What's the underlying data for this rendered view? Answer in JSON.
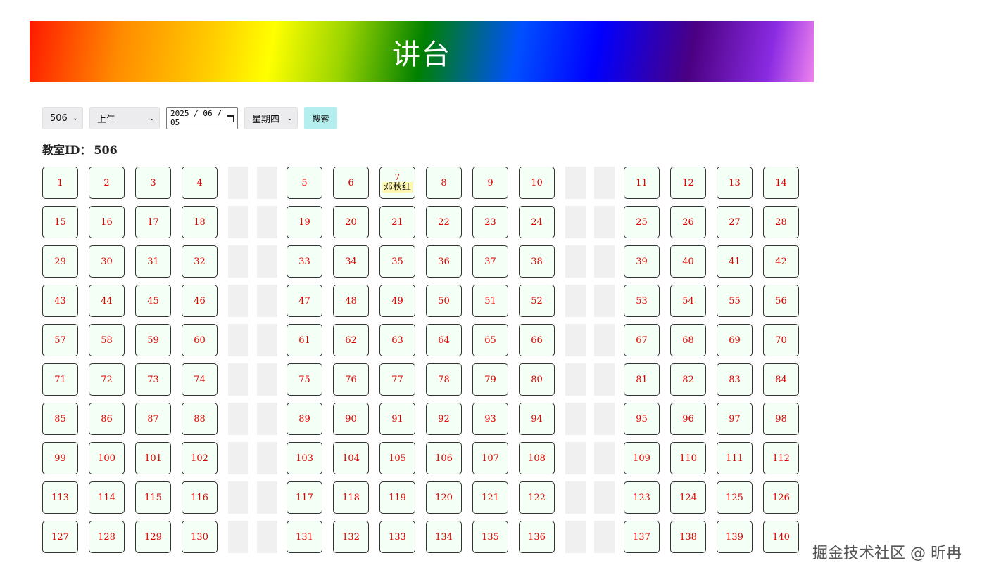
{
  "banner": {
    "title": "讲台"
  },
  "toolbar": {
    "room_select": "506",
    "period_select": "上午",
    "date_value": "2025 / 06 / 05",
    "weekday_select": "星期四",
    "search_label": "搜索"
  },
  "room": {
    "label": "教室ID：",
    "id": "506"
  },
  "seats": {
    "columns": [
      [
        1,
        2,
        3,
        4
      ],
      [
        5,
        6,
        7,
        8,
        9,
        10
      ],
      [
        11,
        12,
        13,
        14
      ]
    ],
    "row_count": 10,
    "seats_per_row": 14,
    "occupied": {
      "7": "邓秋红"
    }
  },
  "watermark": "掘金技术社区 @ 昕冉"
}
